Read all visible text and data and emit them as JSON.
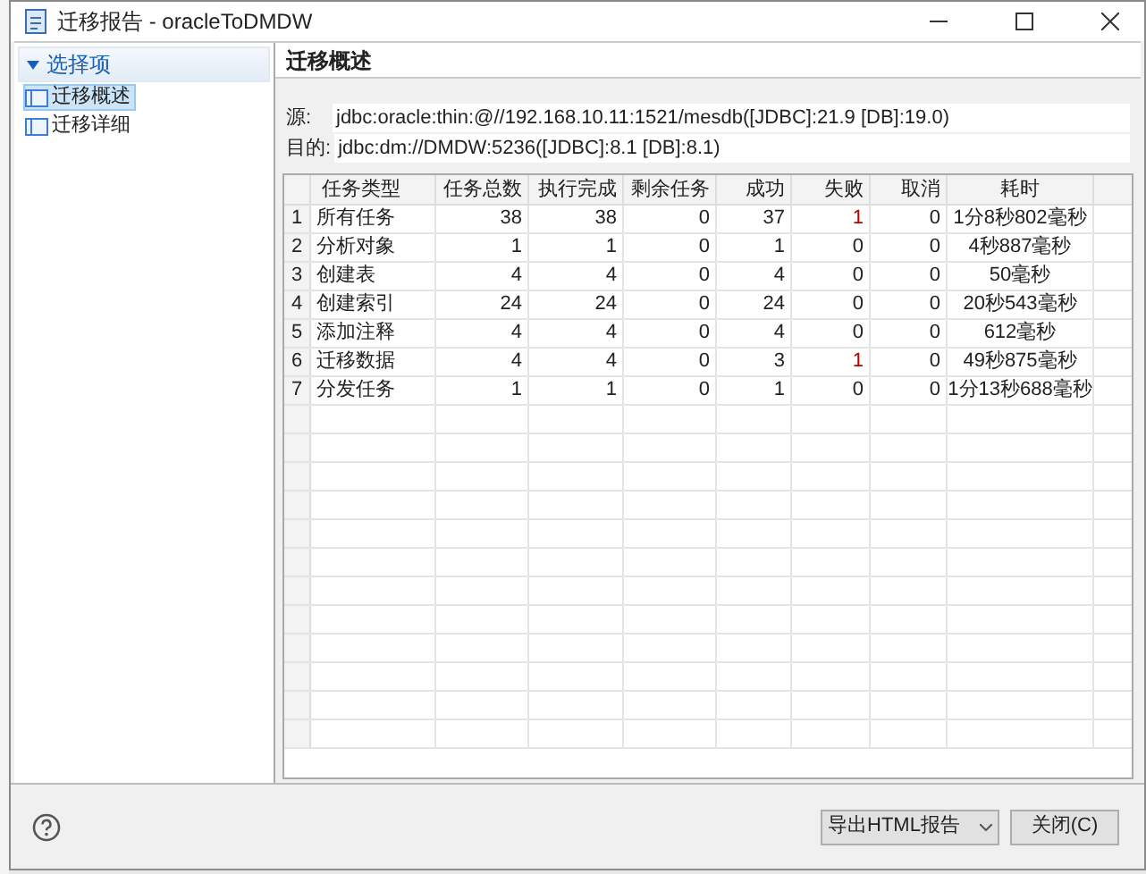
{
  "window": {
    "title": "迁移报告 - oracleToDMDW"
  },
  "sidebar": {
    "header": "选择项",
    "expanded": true,
    "items": [
      {
        "label": "迁移概述",
        "selected": true
      },
      {
        "label": "迁移详细",
        "selected": false
      }
    ]
  },
  "panel": {
    "title": "迁移概述",
    "source_label": "源:",
    "source": "jdbc:oracle:thin:@//192.168.10.11:1521/mesdb([JDBC]:21.9 [DB]:19.0)",
    "target_label": "目的:",
    "target": "jdbc:dm://DMDW:5236([JDBC]:8.1 [DB]:8.1)"
  },
  "table": {
    "columns": [
      "任务类型",
      "任务总数",
      "执行完成",
      "剩余任务",
      "成功",
      "失败",
      "取消",
      "耗时"
    ],
    "rows": [
      {
        "index": "1",
        "cells": [
          "所有任务",
          "38",
          "38",
          "0",
          "37",
          "1",
          "0",
          "1分8秒802毫秒"
        ],
        "fail_alert": true
      },
      {
        "index": "2",
        "cells": [
          "分析对象",
          "1",
          "1",
          "0",
          "1",
          "0",
          "0",
          "4秒887毫秒"
        ],
        "fail_alert": false
      },
      {
        "index": "3",
        "cells": [
          "创建表",
          "4",
          "4",
          "0",
          "4",
          "0",
          "0",
          "50毫秒"
        ],
        "fail_alert": false
      },
      {
        "index": "4",
        "cells": [
          "创建索引",
          "24",
          "24",
          "0",
          "24",
          "0",
          "0",
          "20秒543毫秒"
        ],
        "fail_alert": false
      },
      {
        "index": "5",
        "cells": [
          "添加注释",
          "4",
          "4",
          "0",
          "4",
          "0",
          "0",
          "612毫秒"
        ],
        "fail_alert": false
      },
      {
        "index": "6",
        "cells": [
          "迁移数据",
          "4",
          "4",
          "0",
          "3",
          "1",
          "0",
          "49秒875毫秒"
        ],
        "fail_alert": true
      },
      {
        "index": "7",
        "cells": [
          "分发任务",
          "1",
          "1",
          "0",
          "1",
          "0",
          "0",
          "1分13秒688毫秒"
        ],
        "fail_alert": false
      }
    ]
  },
  "footer": {
    "export": "导出HTML报告",
    "close": "关闭(C)"
  }
}
